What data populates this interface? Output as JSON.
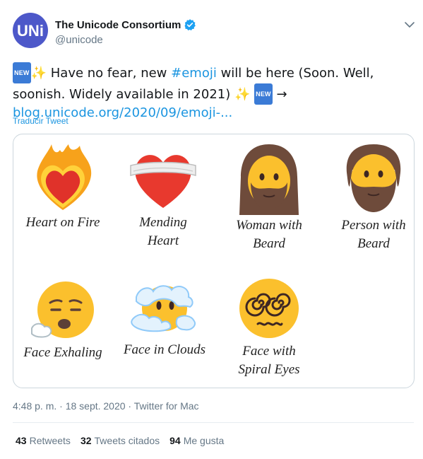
{
  "author": {
    "display_name": "The Unicode Consortium",
    "handle": "@unicode",
    "avatar_text": "UNi"
  },
  "tweet": {
    "badge_new": "NEW",
    "sparkle": "✨",
    "text_part1": " Have no fear, new ",
    "hashtag": "#emoji",
    "text_part2": " will be here (Soon. Well, soonish. Widely available in 2021) ",
    "arrow": " →",
    "link": "blog.unicode.org/2020/09/emoji-...",
    "translate_label": "Traducir Tweet"
  },
  "media": {
    "emojis": [
      {
        "label": "Heart on Fire",
        "icon": "heart-on-fire-icon"
      },
      {
        "label": "Mending\nHeart",
        "icon": "mending-heart-icon"
      },
      {
        "label": "Woman with\nBeard",
        "icon": "woman-with-beard-icon"
      },
      {
        "label": "Person with\nBeard",
        "icon": "person-with-beard-icon"
      },
      {
        "label": "Face Exhaling",
        "icon": "face-exhaling-icon"
      },
      {
        "label": "Face in Clouds",
        "icon": "face-in-clouds-icon"
      },
      {
        "label": "Face with\nSpiral Eyes",
        "icon": "face-with-spiral-eyes-icon"
      }
    ]
  },
  "meta": {
    "timestamp": "4:48 p. m. · 18 sept. 2020 · Twitter for Mac"
  },
  "stats": {
    "retweets_count": "43",
    "retweets_label": "Retweets",
    "quotes_count": "32",
    "quotes_label": "Tweets citados",
    "likes_count": "94",
    "likes_label": "Me gusta"
  },
  "colors": {
    "link": "#1b95e0",
    "avatar": "#4d58c9",
    "muted": "#657786"
  }
}
